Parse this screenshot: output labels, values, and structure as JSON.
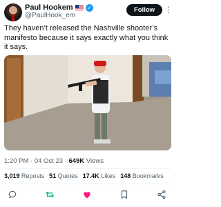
{
  "author": {
    "name": "Paul Hookem",
    "flag_icon": "us-flag-icon",
    "verified_icon": "verified-badge-icon",
    "verified_mark": "✓",
    "handle": "@PaulHook_em"
  },
  "header": {
    "follow_label": "Follow",
    "more_icon": "more-vertical-icon",
    "more_glyph": "⋮"
  },
  "tweet": {
    "text": "They haven’t released the Nashville shooter’s manifesto because it says exactly what you think it says."
  },
  "media": {
    "type": "photo"
  },
  "meta": {
    "time": "1:20 PM",
    "date": "04 Oct 23",
    "views": "649K",
    "views_label": "Views",
    "sep1": "·",
    "sep2": "·"
  },
  "stats": {
    "reposts": "3,019",
    "reposts_label": "Reposts",
    "quotes": "51",
    "quotes_label": "Quotes",
    "likes": "17.4K",
    "likes_label": "Likes",
    "bookmarks": "148",
    "bookmarks_label": "Bookmarks"
  },
  "actions": {
    "reply_icon": "reply-icon",
    "repost_icon": "repost-icon",
    "like_icon": "heart-icon",
    "bookmark_icon": "bookmark-icon",
    "share_icon": "share-icon"
  },
  "colors": {
    "text": "#0f1419",
    "secondary": "#536471",
    "verified": "#1d9bf0",
    "repost_green": "#00ba7c",
    "like_pink": "#f91880"
  }
}
